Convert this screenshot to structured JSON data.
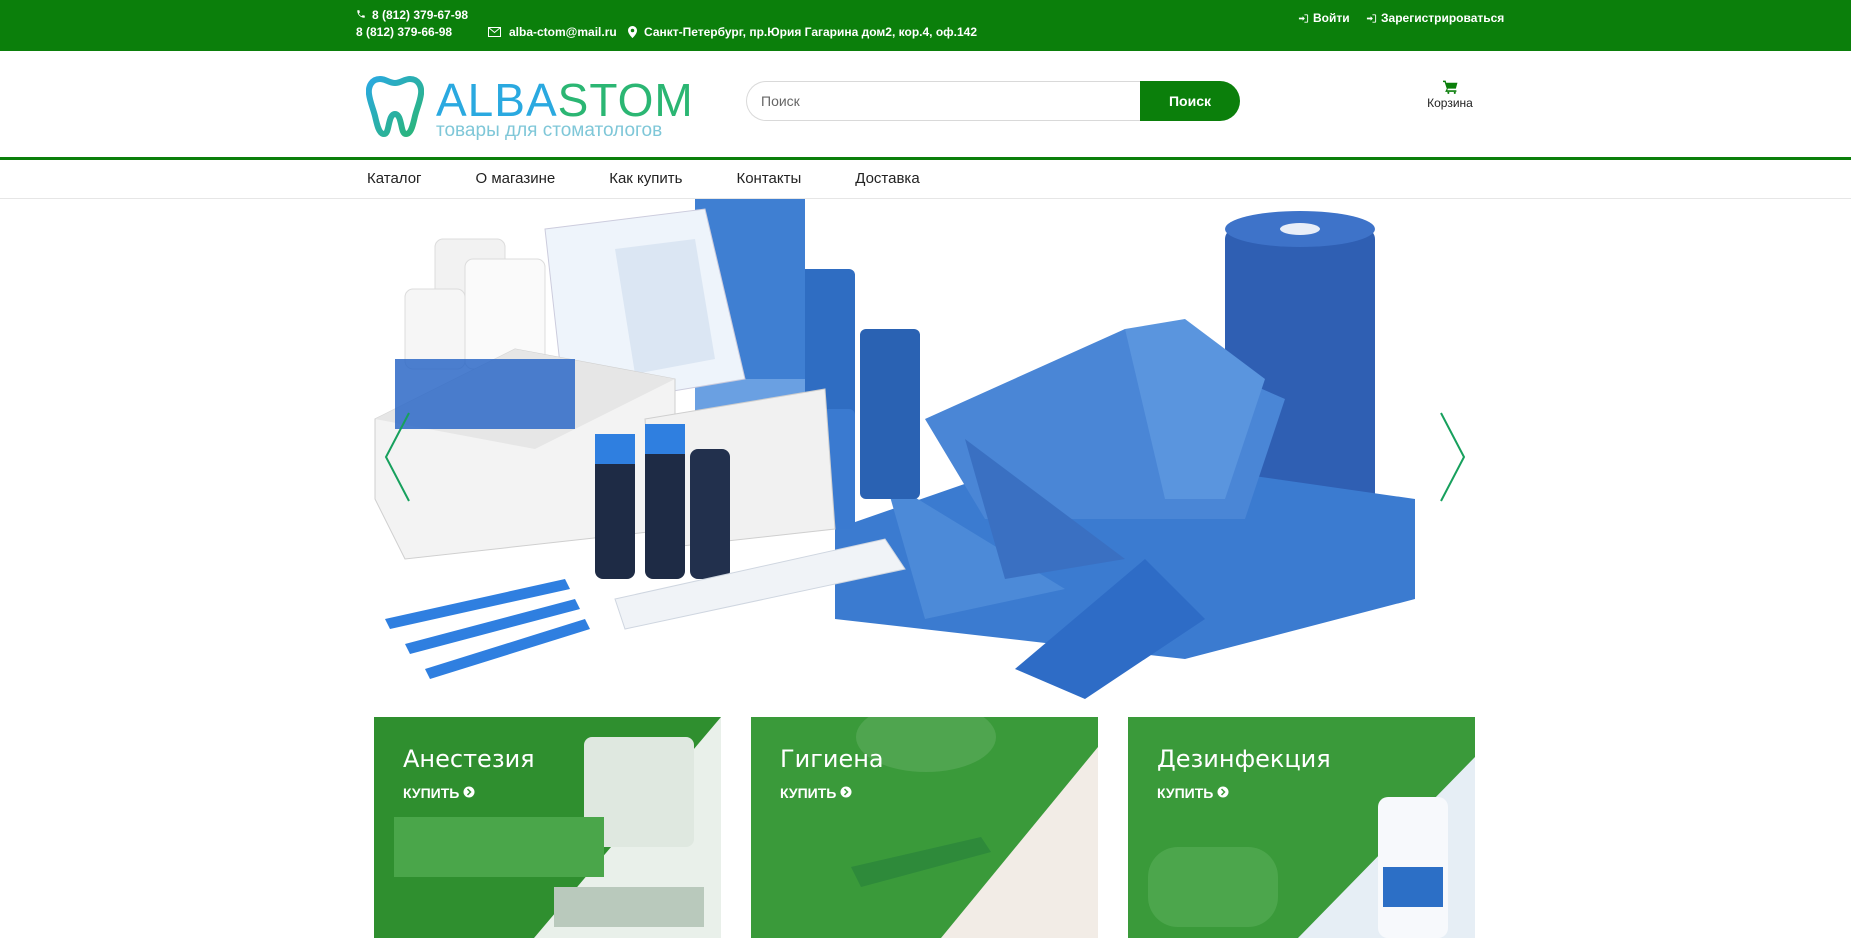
{
  "topbar": {
    "phone1": "8 (812) 379-67-98",
    "phone2": "8 (812) 379-66-98",
    "email": "alba-ctom@mail.ru",
    "address": "Санкт-Петербург, пр.Юрия Гагарина дом2, кор.4, оф.142",
    "login": "Войти",
    "register": "Зарегистрироваться"
  },
  "logo": {
    "name_part1": "ALBA",
    "name_part2": "STOM",
    "tagline": "товары для стоматологов"
  },
  "search": {
    "placeholder": "Поиск",
    "button": "Поиск"
  },
  "cart": {
    "label": "Корзина"
  },
  "nav": {
    "items": [
      "Каталог",
      "О магазине",
      "Как купить",
      "Контакты",
      "Доставка"
    ]
  },
  "tiles": [
    {
      "title": "Анестезия",
      "buy": "КУПИТЬ"
    },
    {
      "title": "Гигиена",
      "buy": "КУПИТЬ"
    },
    {
      "title": "Дезинфекция",
      "buy": "КУПИТЬ"
    }
  ],
  "colors": {
    "brand_green": "#0b7f0b",
    "accent_blue": "#2aa9e0",
    "tile_green": "#3f9d3f"
  }
}
